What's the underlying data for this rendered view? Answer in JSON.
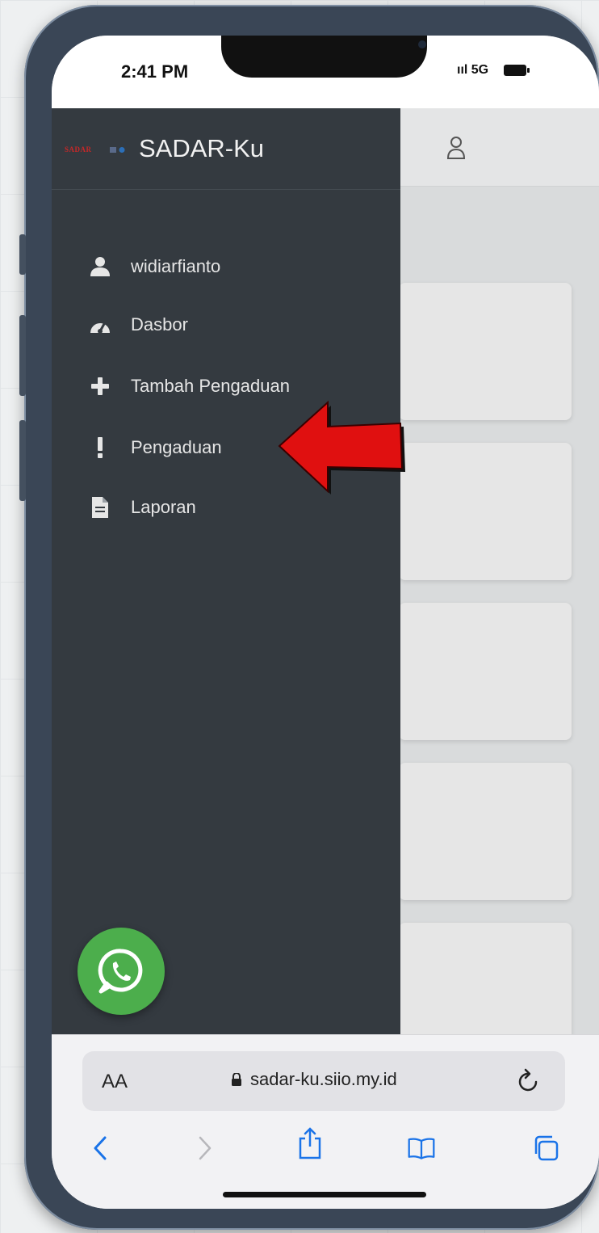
{
  "status_bar": {
    "time": "2:41 PM",
    "signal": "ııl 5G"
  },
  "sidebar": {
    "brand": {
      "logo_text": "SADAR",
      "title": "SADAR-Ku"
    },
    "items": [
      {
        "label": "widiarfianto",
        "icon": "user-icon"
      },
      {
        "label": "Dasbor",
        "icon": "tachometer-icon"
      },
      {
        "label": "Tambah Pengaduan",
        "icon": "plus-icon"
      },
      {
        "label": "Pengaduan",
        "icon": "exclamation-icon"
      },
      {
        "label": "Laporan",
        "icon": "file-icon"
      }
    ]
  },
  "browser": {
    "text_size_label": "AA",
    "url": "sadar-ku.siio.my.id"
  },
  "colors": {
    "sidebar_bg": "#343a40",
    "whatsapp": "#4cae4c",
    "annotation_arrow": "#e01010"
  }
}
